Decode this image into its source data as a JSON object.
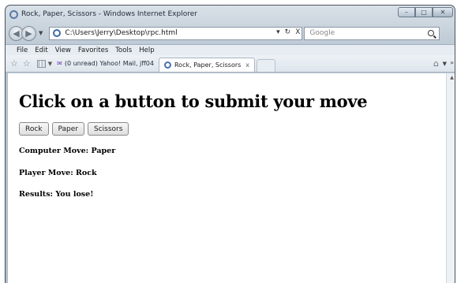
{
  "window": {
    "title": "Rock, Paper, Scissors - Windows Internet Explorer",
    "controls": {
      "minimize": "–",
      "maximize": "□",
      "close": "✕"
    }
  },
  "address": {
    "url": "C:\\Users\\Jerry\\Desktop\\rpc.html",
    "refresh_symbol": "↻",
    "stop_symbol": "X",
    "dropdown_symbol": "▾"
  },
  "search": {
    "placeholder": "Google"
  },
  "menu": [
    "File",
    "Edit",
    "View",
    "Favorites",
    "Tools",
    "Help"
  ],
  "favorites_bar": {
    "item": "(0 unread) Yahoo! Mail, jff04"
  },
  "tab": {
    "label": "Rock, Paper, Scissors",
    "close": "x"
  },
  "page": {
    "heading": "Click on a button to submit your move",
    "buttons": [
      "Rock",
      "Paper",
      "Scissors"
    ],
    "computer_move": "Computer Move: Paper",
    "player_move": "Player Move: Rock",
    "results": "Results: You lose!"
  }
}
